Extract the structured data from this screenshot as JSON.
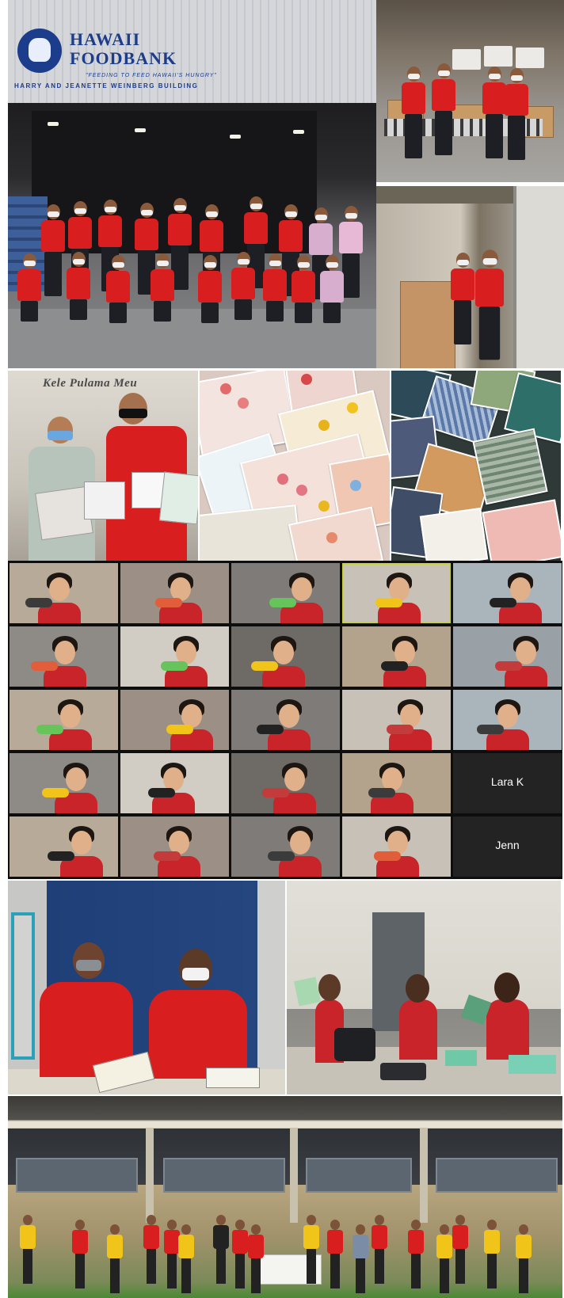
{
  "foodbank": {
    "name": "HAWAII\nFOODBANK",
    "tagline": "\"FEEDING TO FEED HAWAII'S HUNGRY\"",
    "building": "HARRY AND JEANETTE WEINBERG BUILDING"
  },
  "sign": {
    "text": "Kele Pulama Meu"
  },
  "zoom": {
    "tile_names": [
      "Lara K",
      "Jenn"
    ]
  },
  "colors": {
    "shirt_red": "#d81e1e",
    "foodbank_blue": "#1c3d8b",
    "zoom_active_border": "#c7d23c",
    "tshirt_yellow": "#f0c419"
  }
}
